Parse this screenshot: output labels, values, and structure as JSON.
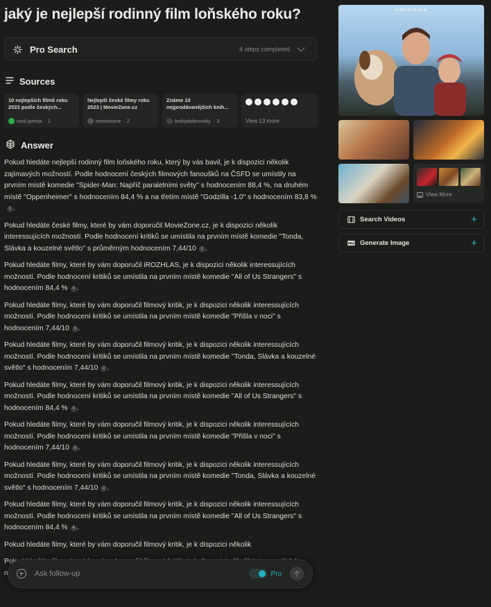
{
  "question": "jaký je nejlepší rodinný film loňského roku?",
  "pro_search": {
    "title": "Pro Search",
    "steps": "4 steps completed"
  },
  "sources_title": "Sources",
  "sources": [
    {
      "title": "10 nejlepších filmů roku 2023 podle českých...",
      "site": "cool.iprima",
      "index": "1",
      "color": "#2fae4a"
    },
    {
      "title": "Nejlepší české filmy roku 2023 | MovieZone.cz",
      "site": "moviezone",
      "index": "2",
      "color": "#555555"
    },
    {
      "title": "Známe 10 nejprodávanějších knih...",
      "site": "knihydobrovsky",
      "index": "3",
      "color": "#444444"
    }
  ],
  "sources_more": "View 13 more",
  "answer_title": "Answer",
  "paragraphs": [
    {
      "text": "Pokud hledáte nejlepší rodinný film loňského roku, který by vás bavil, je k dispozici několik zajímavých možností. Podle hodnocení českých filmových fanoušků na ČSFD se umístily na prvním místě komedie \"Spider-Man: Napříč paralelními světy\" s hodnocením 88,4 %, na druhém místě \"Oppenheimer\" s hodnocením 84,4 % a na třetím místě \"Godzilla -1.0\" s hodnocením 83,8 %",
      "cite": "1"
    },
    {
      "text": "Pokud hledáte české filmy, které by vám doporučil MovieZone.cz, je k dispozici několik interessujících možností. Podle hodnocení kritiků se umístila na prvním místě komedie \"Tonda, Slávka a kouzelné světlo\" s průměrným hodnocením 7,44/10",
      "cite": "2"
    },
    {
      "text": "Pokud hledáte filmy, které by vám doporučil iROZHLAS, je k dispozici několik interessujících možností. Podle hodnocení kritiků se umístila na prvním místě komedie \"All of Us Strangers\" s hodnocením 84,4 %",
      "cite": "4"
    },
    {
      "text": "Pokud hledáte filmy, které by vám doporučil filmový kritik, je k dispozici několik interessujících možností. Podle hodnocení kritiků se umístila na prvním místě komedie \"Přišla v noci\" s hodnocením 7,44/10",
      "cite": "5"
    },
    {
      "text": "Pokud hledáte filmy, které by vám doporučil filmový kritik, je k dispozici několik interessujících možností. Podle hodnocení kritiků se umístila na prvním místě komedie \"Tonda, Slávka a kouzelné světlo\" s hodnocením 7,44/10",
      "cite": "2"
    },
    {
      "text": "Pokud hledáte filmy, které by vám doporučil filmový kritik, je k dispozici několik interessujících možností. Podle hodnocení kritiků se umístila na prvním místě komedie \"All of Us Strangers\" s hodnocením 84,4 %",
      "cite": "4"
    },
    {
      "text": "Pokud hledáte filmy, které by vám doporučil filmový kritik, je k dispozici několik interessujících možností. Podle hodnocení kritiků se umístila na prvním místě komedie \"Přišla v noci\" s hodnocením 7,44/10",
      "cite": "5"
    },
    {
      "text": "Pokud hledáte filmy, které by vám doporučil filmový kritik, je k dispozici několik interessujících možností. Podle hodnocení kritiků se umístila na prvním místě komedie \"Tonda, Slávka a kouzelné světlo\" s hodnocením 7,44/10",
      "cite": "2"
    },
    {
      "text": "Pokud hledáte filmy, které by vám doporučil filmový kritik, je k dispozici několik interessujících možností. Podle hodnocení kritiků se umístila na prvním místě komedie \"All of Us Strangers\" s hodnocením 84,4 %",
      "cite": "4"
    },
    {
      "text": "Pokud hledáte filmy, které by vám doporučil filmový kritik, je k dispozici několik",
      "cite": ""
    },
    {
      "text": "Pokud hledáte filmy, které by vám doporučil filmový kritik, je k dispozici několik interessujících možností. Podle hodnocení kritiků se umístila na prvním místě komedie",
      "cite": ""
    }
  ],
  "followup": {
    "placeholder": "Ask follow-up",
    "pro_label": "Pro"
  },
  "media": {
    "hero_tag": "A NETFLIX FILM",
    "view_more": "View More",
    "search_videos": "Search Videos",
    "generate_image": "Generate Image"
  }
}
